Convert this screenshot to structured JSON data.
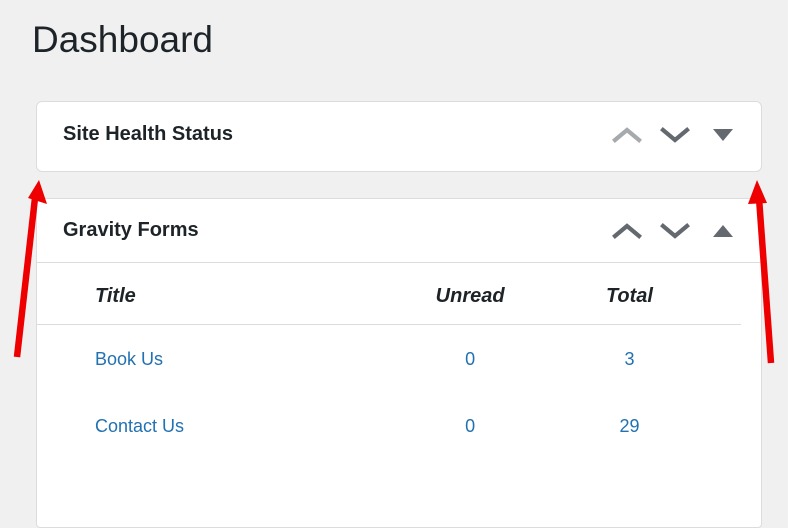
{
  "page": {
    "title": "Dashboard",
    "background_color": "#f0f0f1",
    "text_color": "#1d2327",
    "link_color": "#2271b1",
    "annotation_color": "#ee0000"
  },
  "panels": [
    {
      "id": "site-health-status",
      "title": "Site Health Status",
      "collapsed": true,
      "actions": [
        {
          "name": "move-up",
          "icon": "chevron-up-icon",
          "state": "disabled"
        },
        {
          "name": "move-down",
          "icon": "chevron-down-icon",
          "state": "enabled"
        },
        {
          "name": "toggle-panel",
          "icon": "triangle-down-icon",
          "state": "enabled"
        }
      ]
    },
    {
      "id": "gravity-forms",
      "title": "Gravity Forms",
      "collapsed": false,
      "actions": [
        {
          "name": "move-up",
          "icon": "chevron-up-icon",
          "state": "enabled"
        },
        {
          "name": "move-down",
          "icon": "chevron-down-icon",
          "state": "enabled"
        },
        {
          "name": "toggle-panel",
          "icon": "triangle-up-icon",
          "state": "enabled"
        }
      ]
    }
  ],
  "gravity_forms_table": {
    "columns": [
      "Title",
      "Unread",
      "Total"
    ],
    "rows": [
      {
        "title": "Book Us",
        "unread": "0",
        "total": "3"
      },
      {
        "title": "Contact Us",
        "unread": "0",
        "total": "29"
      }
    ]
  },
  "annotations": [
    {
      "name": "left-arrow",
      "shape": "arrow",
      "color": "#ee0000",
      "points": "from (17,357) to (39,180)"
    },
    {
      "name": "right-arrow",
      "shape": "arrow",
      "color": "#ee0000",
      "points": "from (771,363) to (757,180)"
    }
  ]
}
